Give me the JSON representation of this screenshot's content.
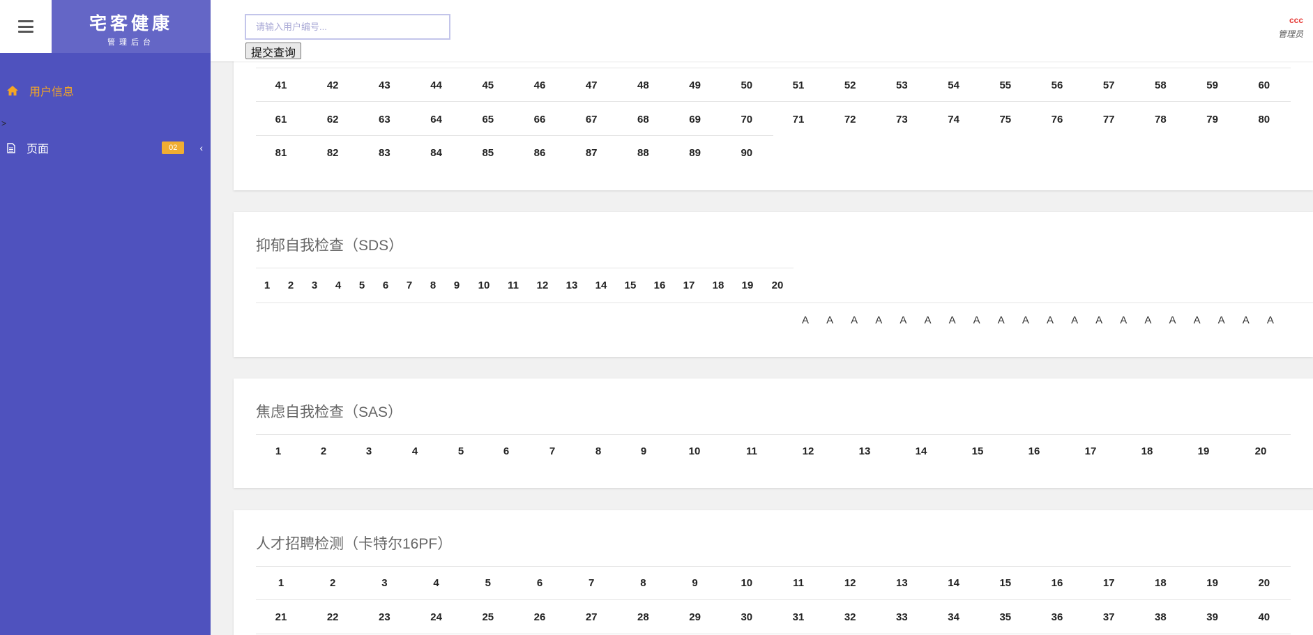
{
  "brand": {
    "title": "宅客健康",
    "subtitle": "管理后台"
  },
  "sidebar": {
    "items": [
      {
        "label": "用户信息",
        "icon": "home-icon",
        "active": true
      },
      {
        "label": "页面",
        "icon": "file-icon",
        "badge": "02"
      }
    ],
    "stray_text": ">"
  },
  "header": {
    "search_placeholder": "请输入用户编号...",
    "submit_label": "提交查询",
    "user_name": "ccc",
    "user_role": "管理员"
  },
  "colors": {
    "sidebar": "#4f52be",
    "brand": "#6466c6",
    "accent": "#f5a623",
    "badge": "#f0ad32",
    "user_name": "#e53935"
  },
  "sections": [
    {
      "title": "",
      "rows": [
        [
          "41",
          "42",
          "43",
          "44",
          "45",
          "46",
          "47",
          "48",
          "49",
          "50",
          "51",
          "52",
          "53",
          "54",
          "55",
          "56",
          "57",
          "58",
          "59",
          "60"
        ],
        [
          "61",
          "62",
          "63",
          "64",
          "65",
          "66",
          "67",
          "68",
          "69",
          "70",
          "71",
          "72",
          "73",
          "74",
          "75",
          "76",
          "77",
          "78",
          "79",
          "80"
        ],
        [
          "81",
          "82",
          "83",
          "84",
          "85",
          "86",
          "87",
          "88",
          "89",
          "90"
        ]
      ]
    },
    {
      "title": "抑郁自我检查（SDS）",
      "rows": [
        [
          "1",
          "2",
          "3",
          "4",
          "5",
          "6",
          "7",
          "8",
          "9",
          "10",
          "11",
          "12",
          "13",
          "14",
          "15",
          "16",
          "17",
          "18",
          "19",
          "20"
        ]
      ],
      "answers": [
        "A",
        "A",
        "A",
        "A",
        "A",
        "A",
        "A",
        "A",
        "A",
        "A",
        "A",
        "A",
        "A",
        "A",
        "A",
        "A",
        "A",
        "A",
        "A",
        "A"
      ]
    },
    {
      "title": "焦虑自我检查（SAS）",
      "rows": [
        [
          "1",
          "2",
          "3",
          "4",
          "5",
          "6",
          "7",
          "8",
          "9",
          "10",
          "11",
          "12",
          "13",
          "14",
          "15",
          "16",
          "17",
          "18",
          "19",
          "20"
        ]
      ]
    },
    {
      "title": "人才招聘检测（卡特尔16PF）",
      "rows": [
        [
          "1",
          "2",
          "3",
          "4",
          "5",
          "6",
          "7",
          "8",
          "9",
          "10",
          "11",
          "12",
          "13",
          "14",
          "15",
          "16",
          "17",
          "18",
          "19",
          "20"
        ],
        [
          "21",
          "22",
          "23",
          "24",
          "25",
          "26",
          "27",
          "28",
          "29",
          "30",
          "31",
          "32",
          "33",
          "34",
          "35",
          "36",
          "37",
          "38",
          "39",
          "40"
        ]
      ]
    }
  ]
}
